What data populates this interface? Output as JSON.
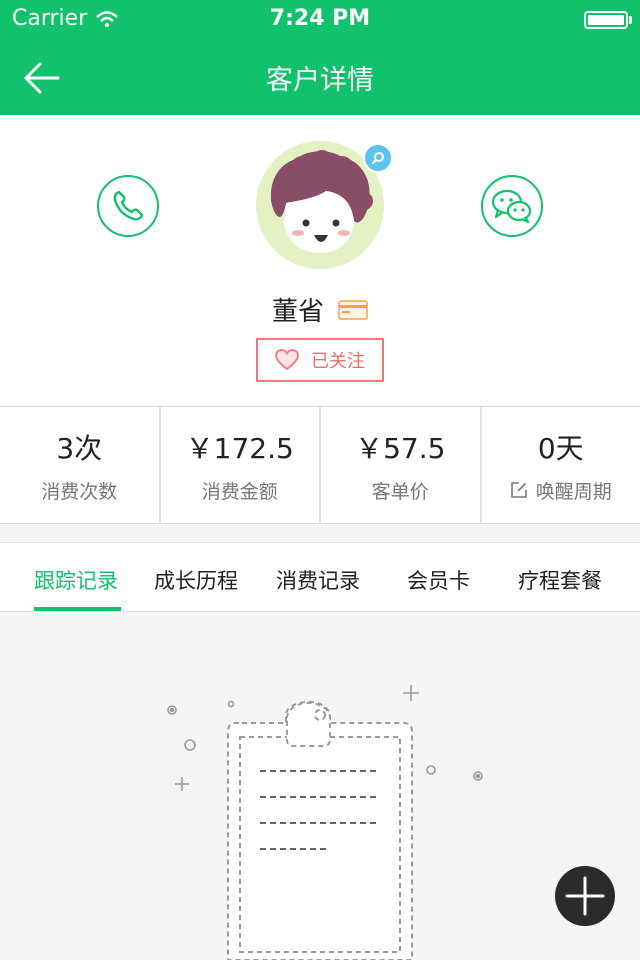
{
  "status_bar": {
    "carrier": "Carrier",
    "time": "7:24 PM"
  },
  "nav": {
    "title": "客户详情",
    "back_icon": "arrow-left-icon"
  },
  "customer": {
    "name": "董省",
    "follow_label": "已关注"
  },
  "stats": [
    {
      "value": "3次",
      "label": "消费次数"
    },
    {
      "value": "￥172.5",
      "label": "消费金额"
    },
    {
      "value": "￥57.5",
      "label": "客单价"
    },
    {
      "value": "0天",
      "label": "唤醒周期"
    }
  ],
  "tabs": [
    "跟踪记录",
    "成长历程",
    "消费记录",
    "会员卡",
    "疗程套餐"
  ],
  "active_tab": "跟踪记录",
  "colors": {
    "primary": "#11c16b",
    "follow": "#ee6b6b",
    "fab": "#2b2b2b"
  }
}
